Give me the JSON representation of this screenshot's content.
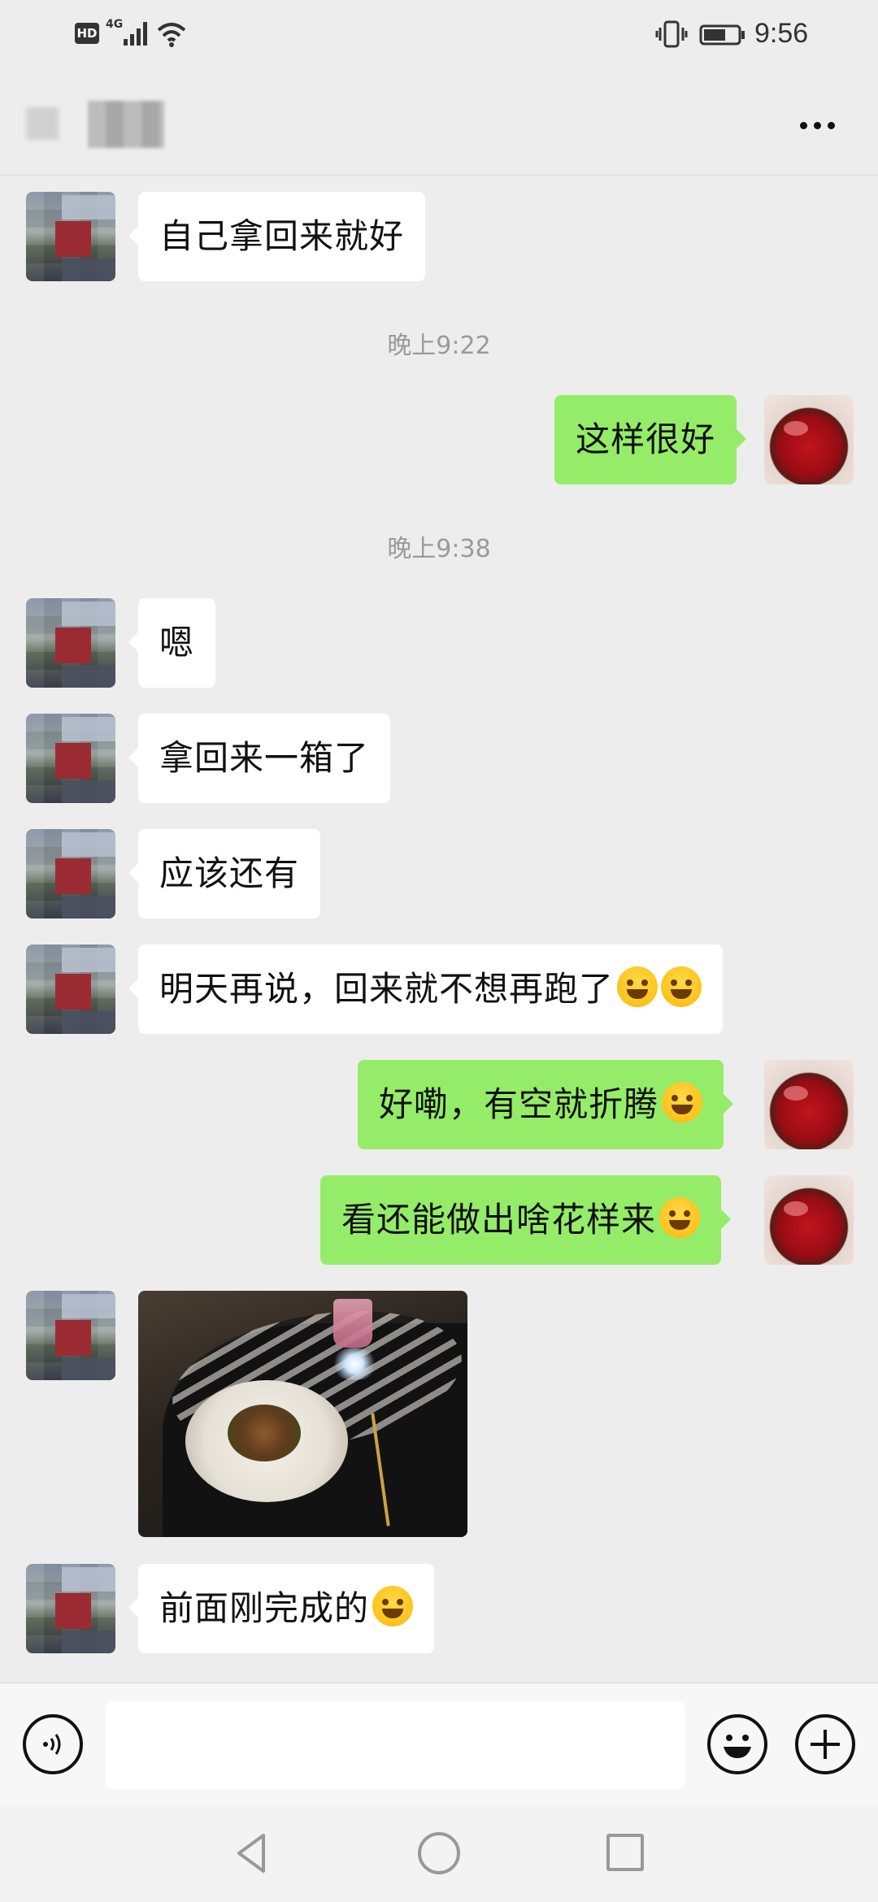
{
  "status_bar": {
    "hd": "HD",
    "network": "4G",
    "time": "9:56"
  },
  "header": {
    "title": "",
    "more_icon": "more-dots-icon"
  },
  "messages": [
    {
      "side": "other",
      "type": "text",
      "text": "自己拿回来就好"
    },
    {
      "type": "timestamp",
      "text": "晚上9:22"
    },
    {
      "side": "self",
      "type": "text",
      "text": "这样很好"
    },
    {
      "type": "timestamp",
      "text": "晚上9:38"
    },
    {
      "side": "other",
      "type": "text",
      "text": "嗯"
    },
    {
      "side": "other",
      "type": "text",
      "text": "拿回来一箱了"
    },
    {
      "side": "other",
      "type": "text",
      "text": "应该还有"
    },
    {
      "side": "other",
      "type": "text",
      "text": "明天再说，回来就不想再跑了",
      "emoji": [
        "tears-of-joy-emoji",
        "crying-laughing-emoji"
      ]
    },
    {
      "side": "self",
      "type": "text",
      "text": "好嘞，有空就折腾",
      "emoji": [
        "grinning-emoji"
      ]
    },
    {
      "side": "self",
      "type": "text",
      "text": "看还能做出啥花样来",
      "emoji": [
        "crying-laughing-emoji"
      ]
    },
    {
      "side": "other",
      "type": "image",
      "image": "pasta-dinner-photo"
    },
    {
      "side": "other",
      "type": "text",
      "text": "前面刚完成的",
      "emoji": [
        "thinking-emoji"
      ]
    }
  ],
  "input_bar": {
    "voice_icon": "voice-icon",
    "input_value": "",
    "emoji_icon": "emoji-icon",
    "plus_icon": "plus-icon"
  },
  "nav_bar": {
    "back_icon": "back-triangle-icon",
    "home_icon": "home-circle-icon",
    "recent_icon": "recent-square-icon"
  }
}
